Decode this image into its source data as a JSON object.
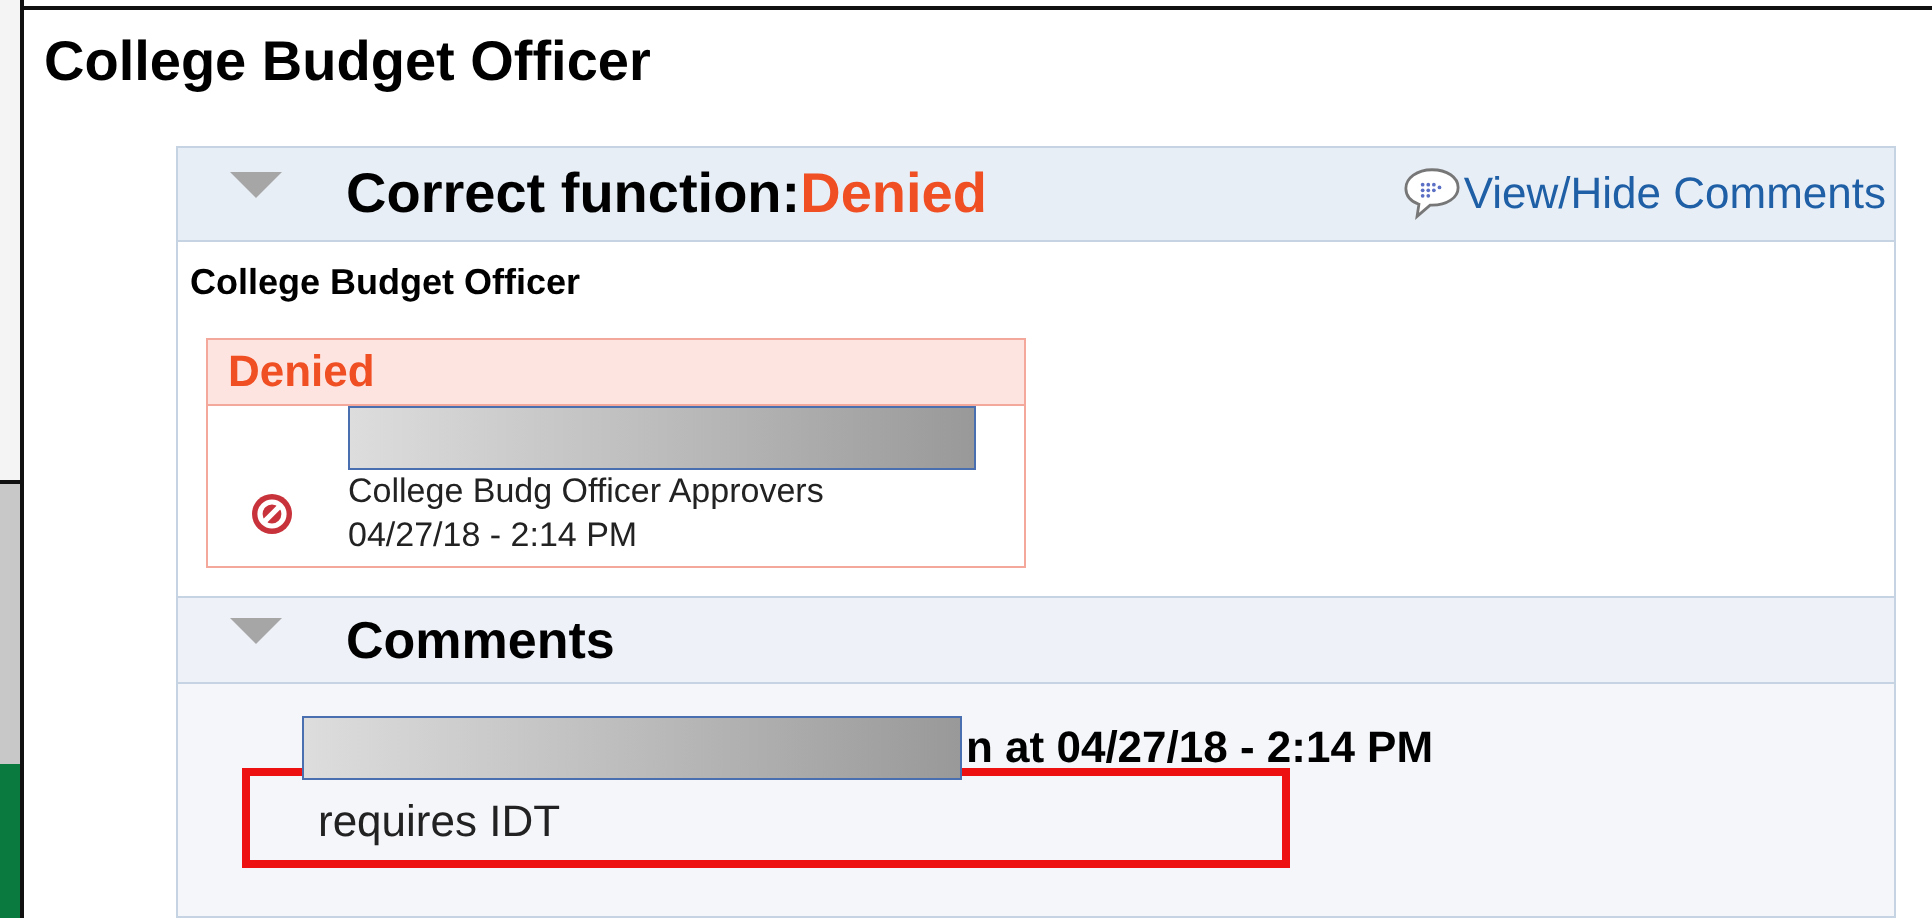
{
  "window": {
    "title": "College Budget Officer"
  },
  "approval": {
    "expanded": true,
    "label": "Correct function:",
    "status": "Denied",
    "link": "View/Hide Comments",
    "stage": "College Budget Officer",
    "step": {
      "status": "Denied",
      "group": "College Budg Officer Approvers",
      "date": "04/27/18 - 2:14 PM"
    }
  },
  "comments": {
    "expanded": true,
    "heading": "Comments",
    "entries": [
      {
        "byline": "n at 04/27/18 - 2:14 PM",
        "text": "requires IDT",
        "highlighted": true
      }
    ]
  }
}
